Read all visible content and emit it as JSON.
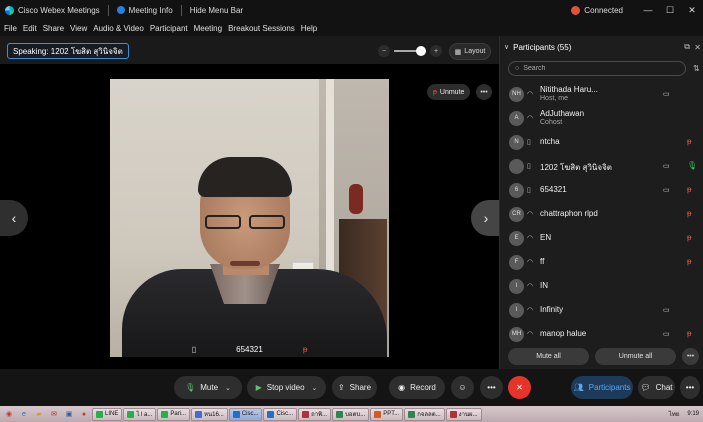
{
  "titlebar": {
    "app_name": "Cisco Webex Meetings",
    "meeting_info": "Meeting Info",
    "hide_menu": "Hide Menu Bar",
    "status": "Connected",
    "minimize": "—",
    "maximize": "☐",
    "close": "✕"
  },
  "menubar": [
    "File",
    "Edit",
    "Share",
    "View",
    "Audio & Video",
    "Participant",
    "Meeting",
    "Breakout Sessions",
    "Help"
  ],
  "speaking": "Speaking: 1202 โฆสิต สุวินิจจิต",
  "layout_label": "Layout",
  "stage": {
    "unmute_label": "Unmute",
    "video_name": "654321"
  },
  "panel": {
    "title": "Participants (55)",
    "search_placeholder": "Search",
    "participants": [
      {
        "initials": "NH",
        "name": "Nitithada Haru...",
        "role": "Host, me",
        "camera": true,
        "mic": ""
      },
      {
        "initials": "A",
        "name": "AdJuthawan",
        "role": "Cohost",
        "camera": false,
        "mic": ""
      },
      {
        "initials": "N",
        "name": "ntcha",
        "role": "",
        "camera": false,
        "mic": "muted"
      },
      {
        "initials": "",
        "name": "1202 โฆสิต สุวินิจจิต",
        "role": "",
        "camera": true,
        "mic": "live"
      },
      {
        "initials": "6",
        "name": "654321",
        "role": "",
        "camera": true,
        "mic": "muted"
      },
      {
        "initials": "CR",
        "name": "chattraphon rlpd",
        "role": "",
        "camera": false,
        "mic": "muted"
      },
      {
        "initials": "E",
        "name": "EN",
        "role": "",
        "camera": false,
        "mic": "muted"
      },
      {
        "initials": "F",
        "name": "ff",
        "role": "",
        "camera": false,
        "mic": "muted"
      },
      {
        "initials": "I",
        "name": "IN",
        "role": "",
        "camera": false,
        "mic": ""
      },
      {
        "initials": "I",
        "name": "Infinity",
        "role": "",
        "camera": true,
        "mic": ""
      },
      {
        "initials": "MH",
        "name": "manop halue",
        "role": "",
        "camera": true,
        "mic": "muted"
      }
    ],
    "mute_all": "Mute all",
    "unmute_all": "Unmute all"
  },
  "controls": {
    "mute": "Mute",
    "stop_video": "Stop video",
    "share": "Share",
    "record": "Record",
    "participants": "Participants",
    "chat": "Chat"
  },
  "taskbar": {
    "tasks": [
      "LINE",
      "ไ l a...",
      "Pari...",
      "หน16...",
      "Cisc...",
      "Cisc...",
      "ถาพิ...",
      "บอตบ...",
      "PPT...",
      "กจลลต...",
      "งานผ..."
    ],
    "lang": "ไทย",
    "time": "9:19"
  },
  "colors": {
    "accent": "#3a8fd6",
    "muted_mic": "#e5533d",
    "live_mic": "#37c45c",
    "leave": "#e5352b"
  }
}
